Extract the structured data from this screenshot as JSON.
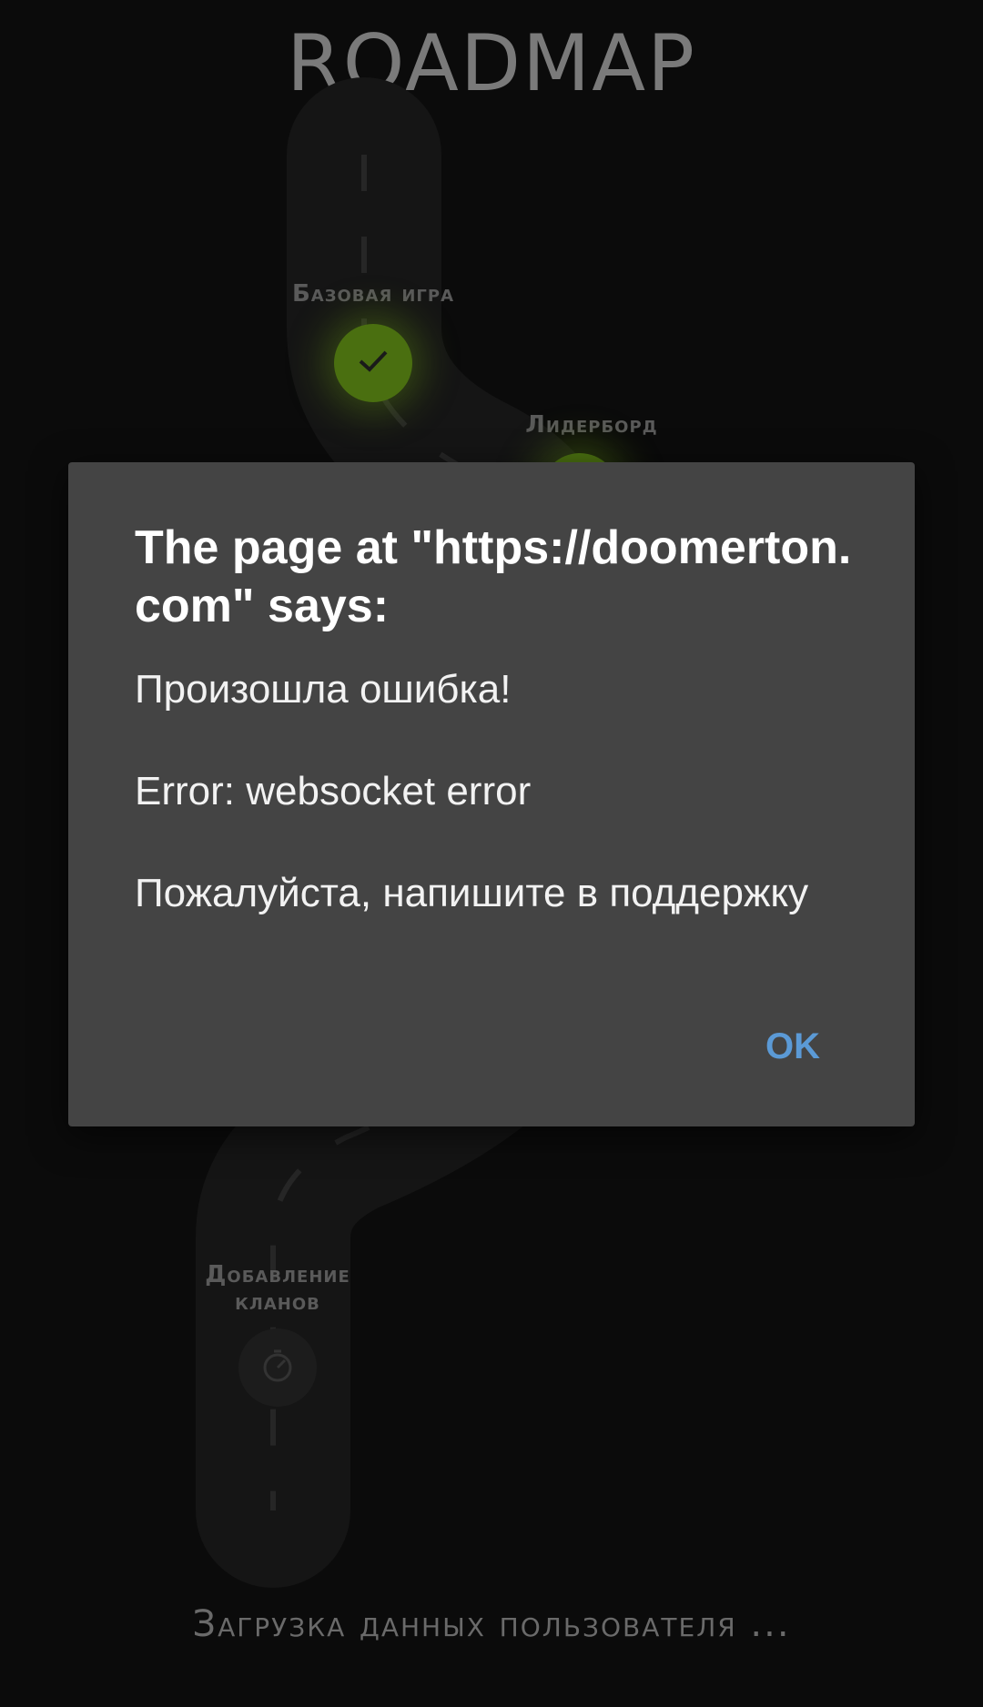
{
  "app": {
    "title": "ROADMAP",
    "milestones": [
      {
        "label": "Базовая игра",
        "status": "done"
      },
      {
        "label": "Лидерборд",
        "status": "done"
      },
      {
        "label": "Добавление кланов",
        "status": "pending"
      }
    ],
    "loading_text": "Загрузка данных пользователя ...",
    "colors": {
      "accent_green": "#4a6f10",
      "background": "#0b0b0b"
    }
  },
  "dialog": {
    "title": "The page at \"https://doomerton.com\" says:",
    "message_lines": [
      "Произошла ошибка!",
      "Error: websocket error",
      "Пожалуйста, напишите в поддержку"
    ],
    "ok_label": "OK",
    "colors": {
      "background": "#444444",
      "button": "#5b9ad6"
    }
  }
}
